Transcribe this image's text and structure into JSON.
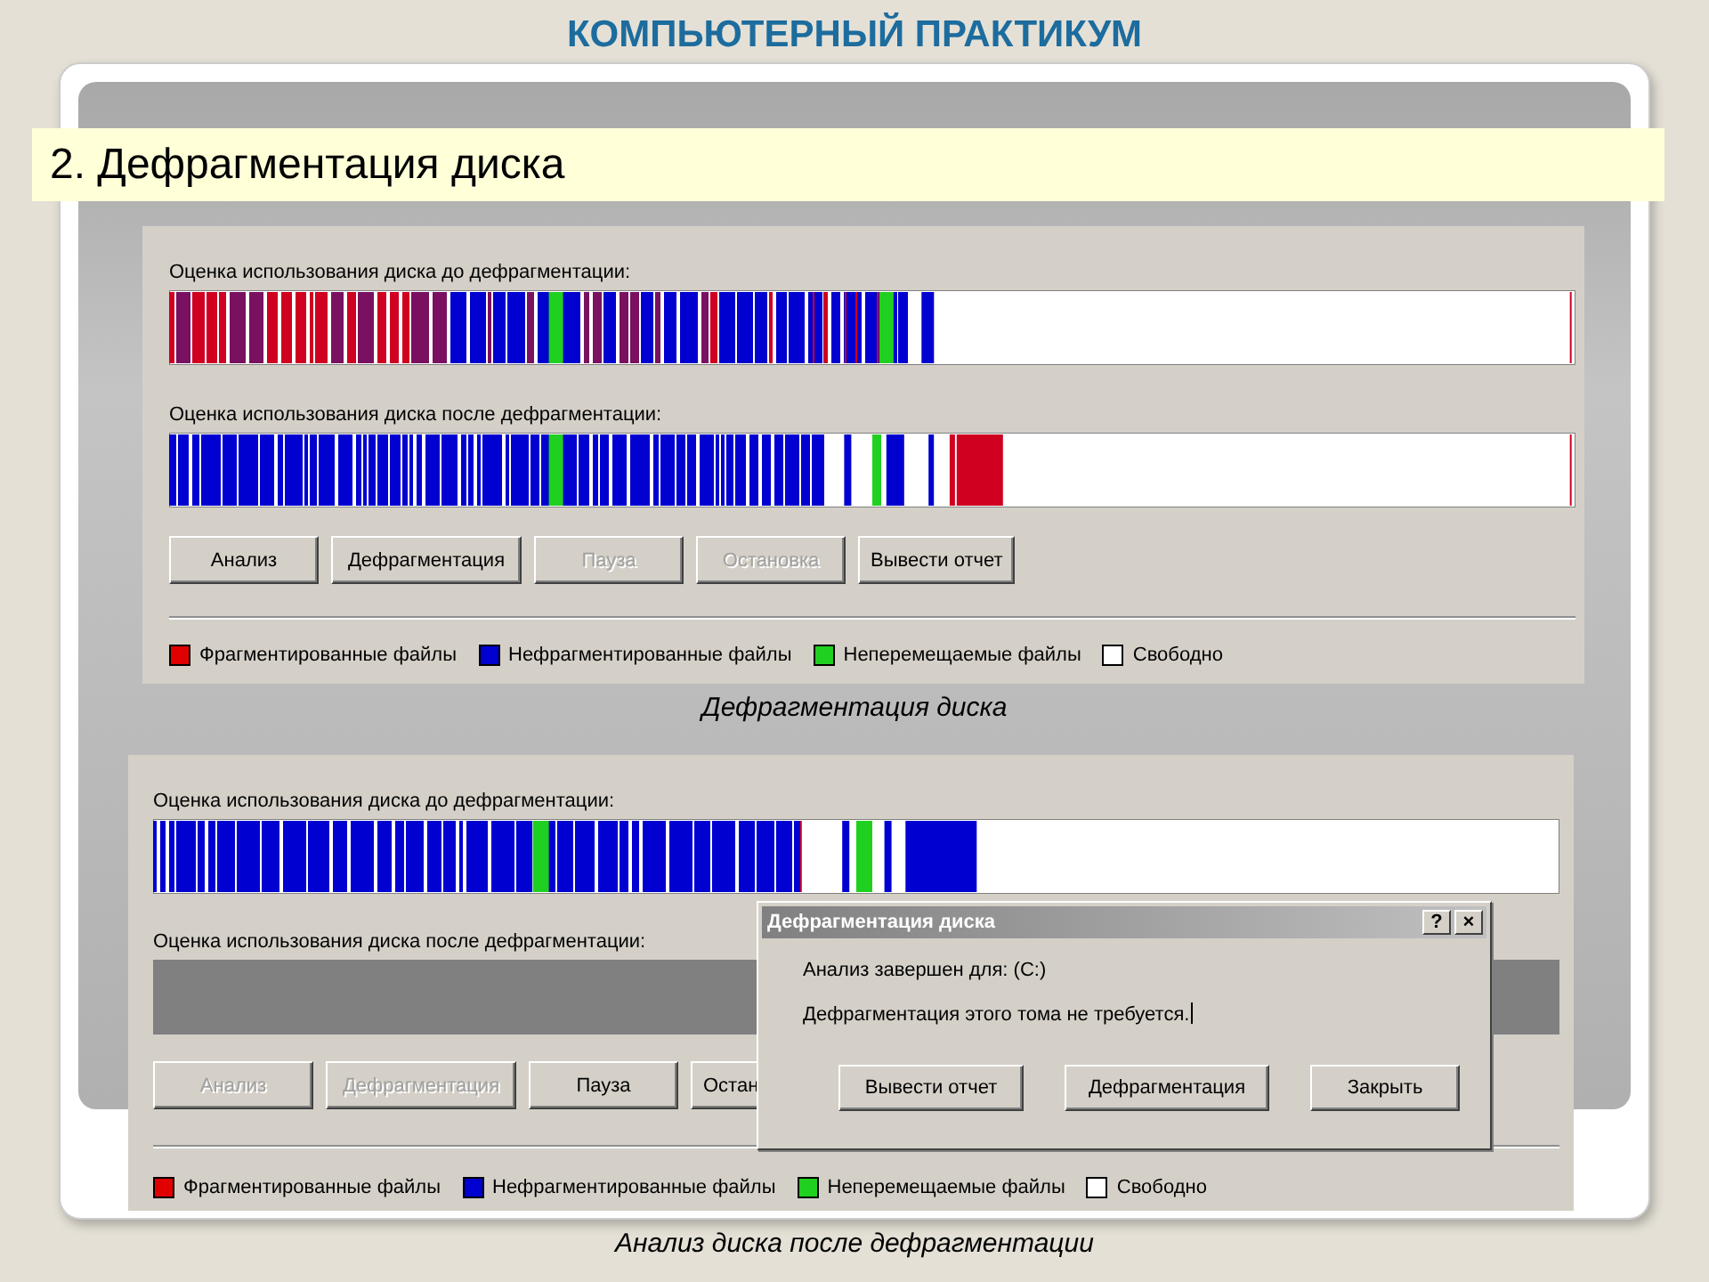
{
  "slide_title": "КОМПЬЮТЕРНЫЙ ПРАКТИКУМ",
  "section_heading": "2. Дефрагментация диска",
  "screenshots": [
    {
      "maps": [
        {
          "label": "Оценка использования диска до дефрагментации:",
          "kind": "fragmented"
        },
        {
          "label": "Оценка использования диска после дефрагментации:",
          "kind": "defragmented"
        }
      ],
      "buttons": [
        {
          "label": "Анализ",
          "disabled": false
        },
        {
          "label": "Дефрагментация",
          "disabled": false
        },
        {
          "label": "Пауза",
          "disabled": true
        },
        {
          "label": "Остановка",
          "disabled": true
        },
        {
          "label": "Вывести отчет",
          "disabled": false
        }
      ],
      "legend": [
        {
          "label": "Фрагментированные файлы",
          "color": "#e00000"
        },
        {
          "label": "Нефрагментированные файлы",
          "color": "#0000d0"
        },
        {
          "label": "Неперемещаемые файлы",
          "color": "#20d020"
        },
        {
          "label": "Свободно",
          "color": "#ffffff"
        }
      ],
      "caption": "Дефрагментация диска"
    },
    {
      "maps": [
        {
          "label": "Оценка использования диска до дефрагментации:",
          "kind": "contiguous"
        },
        {
          "label": "Оценка использования диска после дефрагментации:",
          "kind": "empty"
        }
      ],
      "buttons": [
        {
          "label": "Анализ",
          "disabled": true
        },
        {
          "label": "Дефрагментация",
          "disabled": true
        },
        {
          "label": "Пауза",
          "disabled": false
        },
        {
          "label": "Остан",
          "disabled": false
        }
      ],
      "legend": [
        {
          "label": "Фрагментированные файлы",
          "color": "#e00000"
        },
        {
          "label": "Нефрагментированные файлы",
          "color": "#0000d0"
        },
        {
          "label": "Неперемещаемые файлы",
          "color": "#20d020"
        },
        {
          "label": "Свободно",
          "color": "#ffffff"
        }
      ],
      "dialog": {
        "title": "Дефрагментация диска",
        "title_buttons": [
          "?",
          "×"
        ],
        "messages": [
          "Анализ завершен для: (C:)",
          "Дефрагментация этого тома не требуется."
        ],
        "buttons": [
          "Вывести отчет",
          "Дефрагментация",
          "Закрыть"
        ]
      },
      "caption": "Анализ диска после дефрагментации"
    }
  ]
}
